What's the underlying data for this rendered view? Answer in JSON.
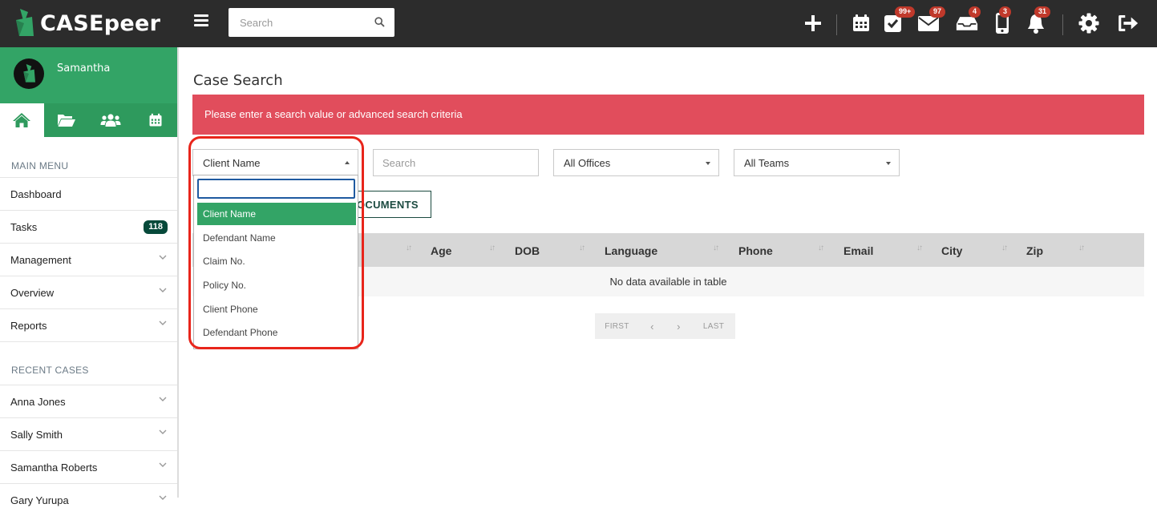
{
  "app": {
    "name": "CASEpeer"
  },
  "topbar": {
    "search_placeholder": "Search",
    "badges": {
      "tasks": "99+",
      "mail": "97",
      "inbox": "4",
      "phone": "3",
      "notifications": "31"
    }
  },
  "sidebar": {
    "user_name": "Samantha",
    "main_menu_title": "MAIN MENU",
    "menu": [
      {
        "label": "Dashboard"
      },
      {
        "label": "Tasks",
        "count": "118"
      },
      {
        "label": "Management"
      },
      {
        "label": "Overview"
      },
      {
        "label": "Reports"
      }
    ],
    "recent_title": "RECENT CASES",
    "recent": [
      {
        "label": "Anna Jones"
      },
      {
        "label": "Sally Smith"
      },
      {
        "label": "Samantha Roberts"
      },
      {
        "label": "Gary Yurupa"
      }
    ]
  },
  "main": {
    "title": "Case Search",
    "alert": "Please enter a search value or advanced search criteria",
    "search_type_selected": "Client Name",
    "search_placeholder": "Search",
    "offices_selected": "All Offices",
    "teams_selected": "All Teams",
    "documents_button": "DOCUMENTS",
    "documents_button_visible": "OCUMENTS",
    "table": {
      "columns": [
        "Age",
        "DOB",
        "Language",
        "Phone",
        "Email",
        "City",
        "Zip"
      ],
      "empty_text": "No data available in table"
    },
    "pager": {
      "first": "FIRST",
      "prev": "‹",
      "next": "›",
      "last": "LAST"
    }
  },
  "dropdown": {
    "options": [
      "Client Name",
      "Defendant Name",
      "Claim No.",
      "Policy No.",
      "Client Phone",
      "Defendant Phone"
    ],
    "selected": "Client Name"
  },
  "colors": {
    "topbar": "#2c2c2c",
    "brand_green": "#33a466",
    "alert_red": "#e14d5c",
    "annotation_red": "#e8251b",
    "badge_red": "#c0392b"
  }
}
